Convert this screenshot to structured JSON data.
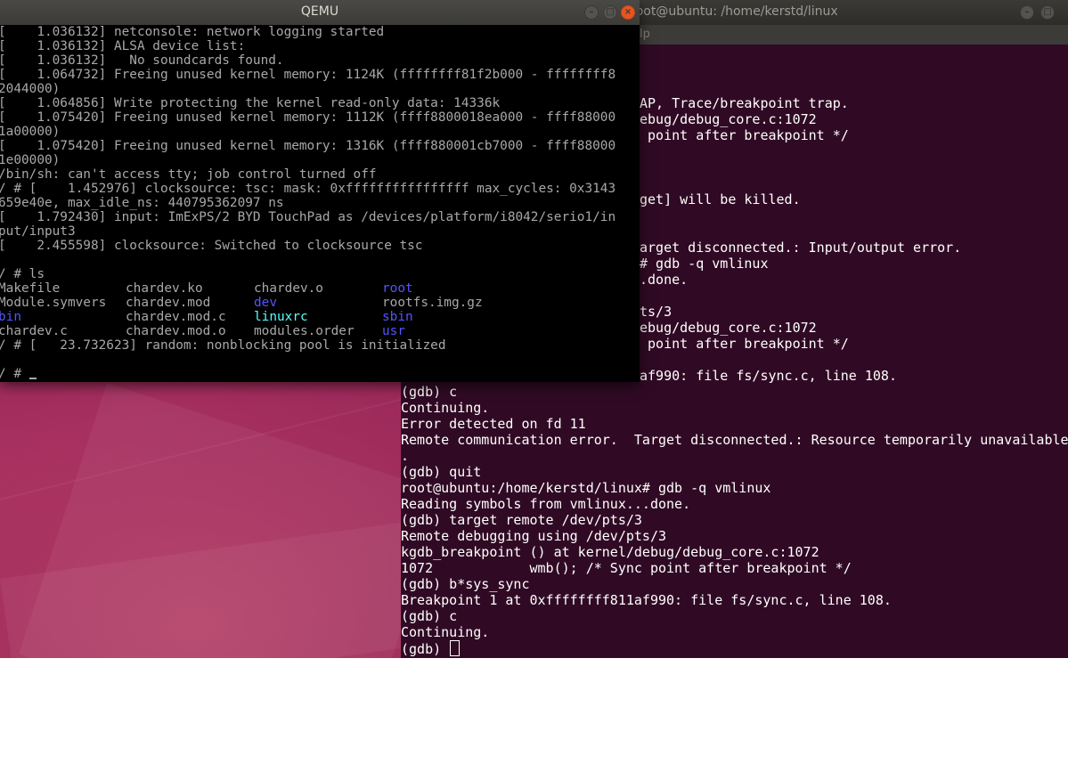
{
  "terminal": {
    "title": "root@ubuntu: /home/kerstd/linux",
    "menu_partial": "lp",
    "lines_right": [
      {
        "text": "AP, Trace/breakpoint trap."
      },
      {
        "text": "ebug/debug_core.c:1072"
      },
      {
        "text": " point after breakpoint */"
      },
      {
        "text": ""
      },
      {
        "text": ""
      },
      {
        "text": ""
      },
      {
        "text": "get] will be killed."
      },
      {
        "text": ""
      },
      {
        "text": ""
      },
      {
        "text": "arget disconnected.: Input/output error."
      },
      {
        "text": "# gdb -q vmlinux"
      },
      {
        "text": ".done."
      },
      {
        "text": ""
      },
      {
        "text": "ts/3"
      },
      {
        "text": "ebug/debug_core.c:1072"
      },
      {
        "text": " point after breakpoint */"
      },
      {
        "text": ""
      },
      {
        "text": "af990: file fs/sync.c, line 108."
      }
    ],
    "lines_full": [
      "(gdb) c",
      "Continuing.",
      "Error detected on fd 11",
      "Remote communication error.  Target disconnected.: Resource temporarily unavailable",
      ".",
      "(gdb) quit",
      "root@ubuntu:/home/kerstd/linux# gdb -q vmlinux",
      "Reading symbols from vmlinux...done.",
      "(gdb) target remote /dev/pts/3",
      "Remote debugging using /dev/pts/3",
      "kgdb_breakpoint () at kernel/debug/debug_core.c:1072",
      "1072            wmb(); /* Sync point after breakpoint */",
      "(gdb) b*sys_sync",
      "Breakpoint 1 at 0xffffffff811af990: file fs/sync.c, line 108.",
      "(gdb) c",
      "Continuing."
    ],
    "prompt": "(gdb) "
  },
  "qemu": {
    "title": "QEMU",
    "boot_lines": [
      "[    1.036132] netconsole: network logging started",
      "[    1.036132] ALSA device list:",
      "[    1.036132]   No soundcards found.",
      "[    1.064732] Freeing unused kernel memory: 1124K (ffffffff81f2b000 - ffffffff8",
      "2044000)",
      "[    1.064856] Write protecting the kernel read-only data: 14336k",
      "[    1.075420] Freeing unused kernel memory: 1112K (ffff8800018ea000 - ffff88000",
      "1a00000)",
      "[    1.075420] Freeing unused kernel memory: 1316K (ffff880001cb7000 - ffff88000",
      "1e00000)",
      "/bin/sh: can't access tty; job control turned off",
      "/ # [    1.452976] clocksource: tsc: mask: 0xffffffffffffffff max_cycles: 0x3143",
      "659e40e, max_idle_ns: 440795362097 ns",
      "[    1.792430] input: ImExPS/2 BYD TouchPad as /devices/platform/i8042/serio1/in",
      "put/input3",
      "[    2.455598] clocksource: Switched to clocksource tsc",
      "",
      "/ # ls"
    ],
    "ls_rows": [
      [
        "Makefile",
        "chardev.ko",
        "chardev.o",
        "root"
      ],
      [
        "Module.symvers",
        "chardev.mod",
        "dev",
        "rootfs.img.gz"
      ],
      [
        "bin",
        "chardev.mod.c",
        "linuxrc",
        "sbin"
      ],
      [
        "chardev.c",
        "chardev.mod.o",
        "modules.order",
        "usr"
      ]
    ],
    "ls_colors": [
      [
        "",
        "",
        "",
        "blue"
      ],
      [
        "",
        "",
        "blue",
        ""
      ],
      [
        "blue",
        "",
        "cyan",
        "blue"
      ],
      [
        "",
        "",
        "",
        "blue"
      ]
    ],
    "after_ls_lines": [
      "/ # [   23.732623] random: nonblocking pool is initialized",
      "",
      "/ # "
    ]
  },
  "colors": {
    "terminal_bg": "#300a24",
    "qemu_close": "#e95420",
    "ls_dir_blue": "#5454ff",
    "ls_link_cyan": "#54ffff"
  }
}
